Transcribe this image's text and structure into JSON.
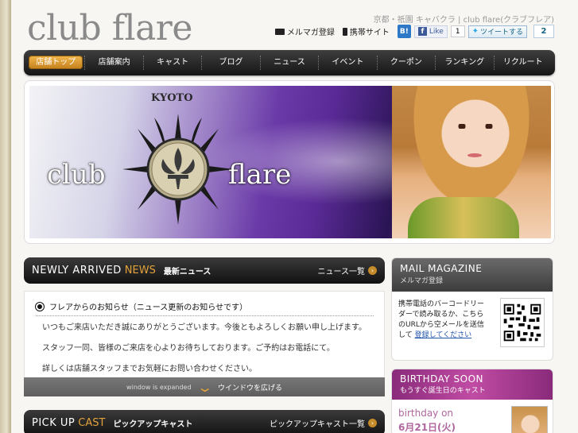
{
  "logo": "club flare",
  "header": {
    "title": "京都・祇園 キャバクラ | club flare(クラブフレア)",
    "mail_link": "メルマガ登録",
    "mobile_link": "携帯サイト",
    "hatena": "B!",
    "fb_like": "Like",
    "fb_count": "1",
    "tweet": "ツイートする",
    "tweet_count": "2"
  },
  "nav": {
    "items": [
      "店舗トップ",
      "店舗案内",
      "キャスト",
      "ブログ",
      "ニュース",
      "イベント",
      "クーポン",
      "ランキング",
      "リクルート"
    ]
  },
  "hero": {
    "kyoto": "KYOTO",
    "club": "club",
    "flare": "flare"
  },
  "news": {
    "heading_en": "NEWLY ARRIVED",
    "heading_accent": "NEWS",
    "heading_ja": "最新ニュース",
    "more": "ニュース一覧",
    "title": "フレアからのお知らせ（ニュース更新のお知らせです）",
    "lines": [
      "いつもご来店いただき誠にありがとうございます。今後ともよろしくお願い申し上げます。",
      "スタッフ一同、皆様のご来店を心よりお待ちしております。ご予約はお電話にて。",
      "詳しくは店舗スタッフまでお気軽にお問い合わせください。"
    ],
    "expand_en": "window is expanded",
    "expand_ja": "ウインドウを広げる"
  },
  "pickup": {
    "heading_en": "PICK UP",
    "heading_accent": "CAST",
    "heading_ja": "ピックアップキャスト",
    "more": "ピックアップキャスト一覧"
  },
  "mail": {
    "heading_en": "MAIL MAGAZINE",
    "heading_ja": "メルマガ登録",
    "text": "携帯電話のバーコードリーダーで読み取るか、こちらのURLから空メールを送信して",
    "link": "登録してください"
  },
  "birthday": {
    "heading_en": "BIRTHDAY SOON",
    "heading_ja": "もうすぐ誕生日のキャスト",
    "label": "birthday on",
    "date": "6月21日(火)"
  },
  "icons": {
    "mail": "mail-icon",
    "mobile": "mobile-phone-icon",
    "arrow": "arrow-right-icon",
    "chevron": "chevron-down-icon",
    "bullet": "radio-bullet-icon"
  }
}
